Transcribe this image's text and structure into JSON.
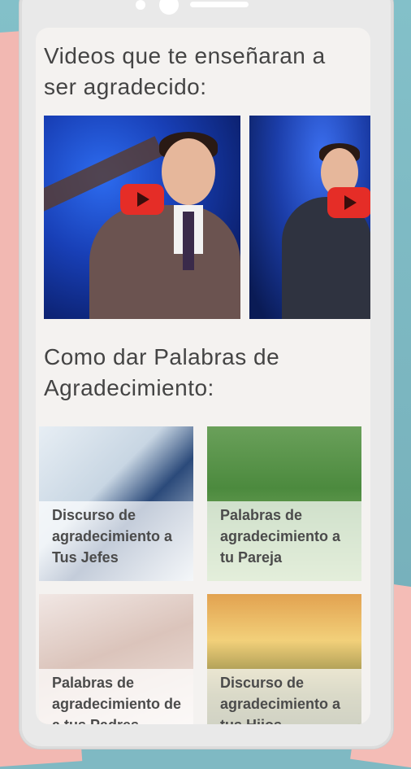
{
  "sections": {
    "videos_heading": "Videos que te enseñaran a ser agradecido:",
    "words_heading": "Como dar Palabras de Agradecimiento:"
  },
  "videos": [
    {
      "icon": "play-icon"
    },
    {
      "icon": "play-icon"
    }
  ],
  "cards": [
    {
      "label": "Discurso de agradecimiento a Tus Jefes"
    },
    {
      "label": "Palabras de agradecimiento a tu Pareja"
    },
    {
      "label": "Palabras de agradecimiento de a tus Padres"
    },
    {
      "label": "Discurso de agradecimiento a tus Hijos"
    }
  ],
  "colors": {
    "background": "#7fb9c3",
    "phone_frame": "#e9e9e9",
    "screen": "#f4f2f0",
    "play_button": "#e52d27",
    "heading_text": "#444444"
  }
}
